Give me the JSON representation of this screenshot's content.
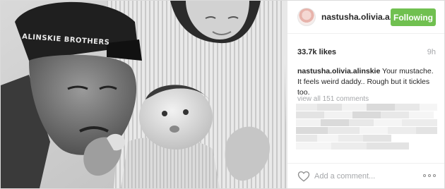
{
  "post": {
    "username": "nastusha.olivia.a...",
    "follow_label": "Following",
    "likes": "33.7k likes",
    "time_ago": "9h",
    "caption": {
      "username": "nastusha.olivia.alinskie",
      "text": "Your mustache. It feels weird daddy.. Rough but it tickles too."
    },
    "view_all_comments": "view all 151 comments",
    "comment_placeholder": "Add a comment...",
    "photo": {
      "cap_text": "ALINSKIE BROTHERS"
    }
  },
  "colors": {
    "follow_button": "#70c050",
    "muted_text": "#a5a7aa",
    "username_text": "#262626"
  },
  "icons": {
    "like": "heart-outline-icon",
    "more": "more-options-icon"
  }
}
